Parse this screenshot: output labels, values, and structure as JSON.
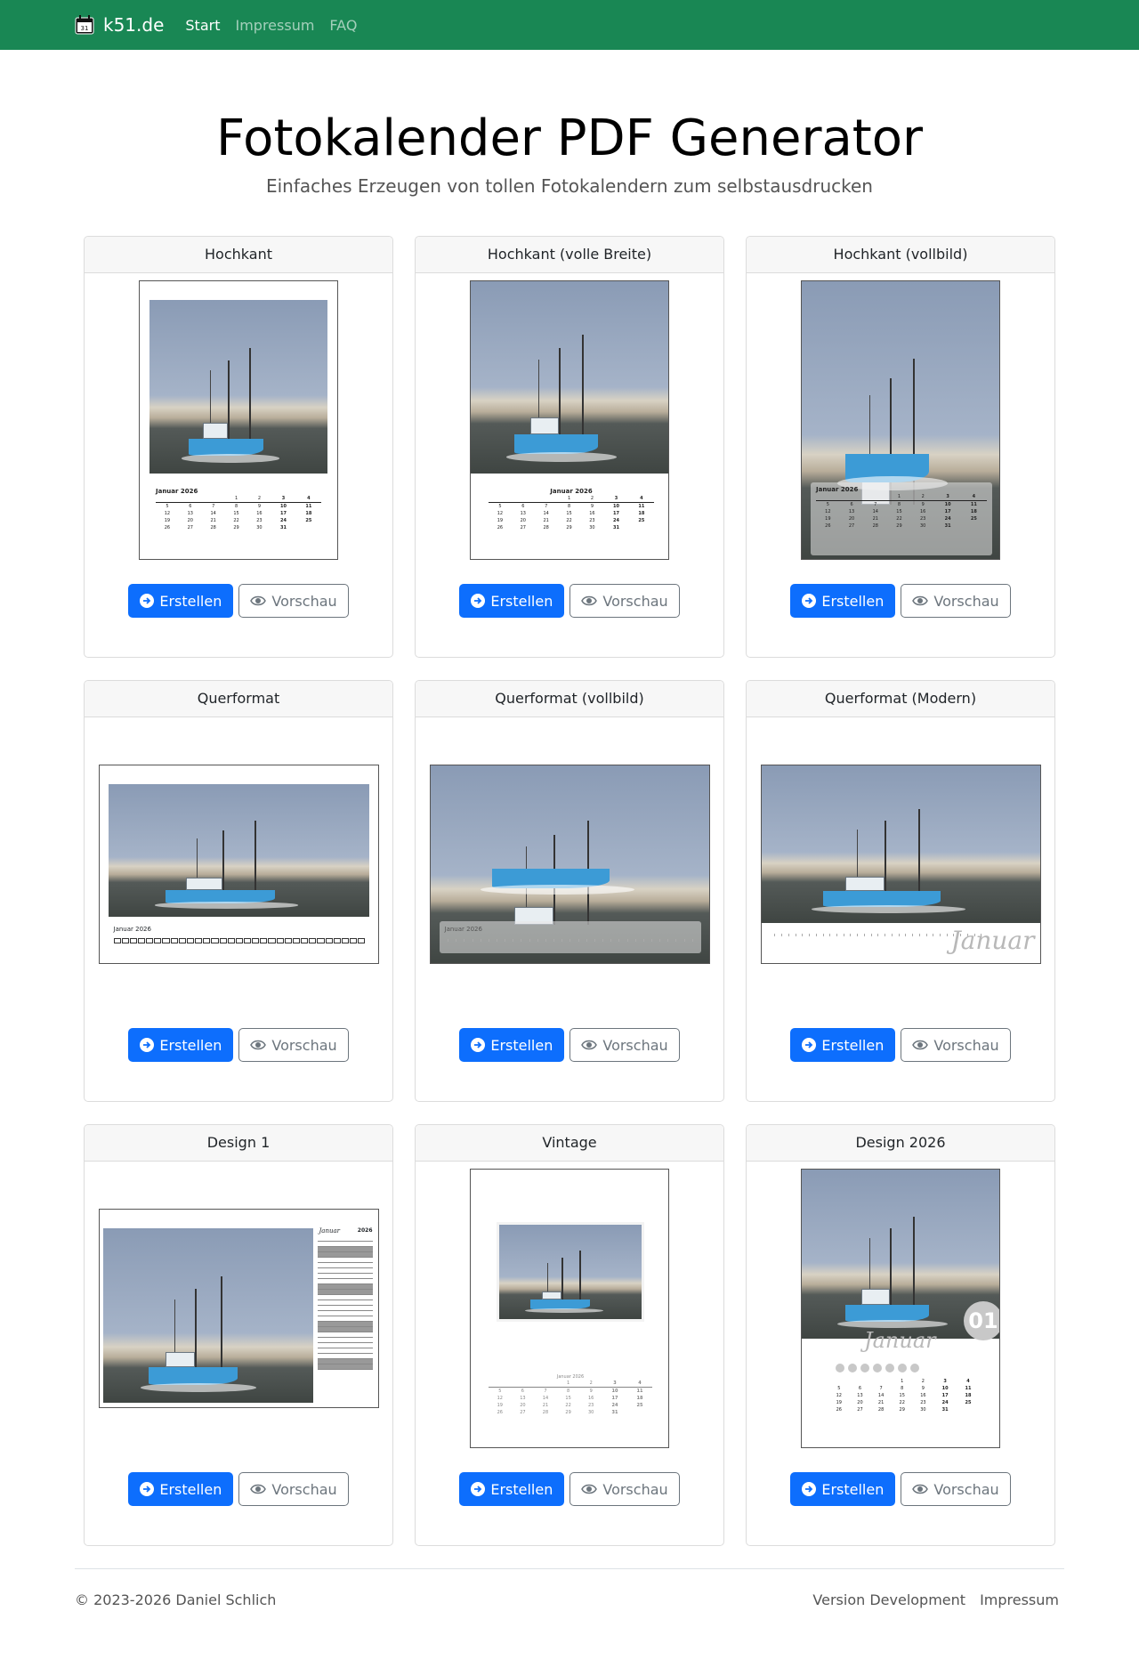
{
  "navbar": {
    "brand": "k51.de",
    "links": [
      "Start",
      "Impressum",
      "FAQ"
    ]
  },
  "hero": {
    "title": "Fotokalender PDF Generator",
    "subtitle": "Einfaches Erzeugen von tollen Fotokalendern zum selbstausdrucken"
  },
  "buttons": {
    "create": "Erstellen",
    "preview": "Vorschau"
  },
  "cards": [
    {
      "title": "Hochkant",
      "month": "Januar 2026"
    },
    {
      "title": "Hochkant (volle Breite)",
      "month": "Januar 2026"
    },
    {
      "title": "Hochkant (vollbild)",
      "month": "Januar 2026"
    },
    {
      "title": "Querformat",
      "month": "Januar 2026"
    },
    {
      "title": "Querformat (vollbild)",
      "month": "Januar 2026"
    },
    {
      "title": "Querformat (Modern)",
      "month": "Januar"
    },
    {
      "title": "Design 1",
      "month": "Januar",
      "year": "2026"
    },
    {
      "title": "Vintage",
      "month": "Januar 2026"
    },
    {
      "title": "Design 2026",
      "month": "Januar",
      "number": "01"
    }
  ],
  "calendar_rows": [
    [
      "",
      "",
      "",
      "1",
      "2",
      "3",
      "4"
    ],
    [
      "5",
      "6",
      "7",
      "8",
      "9",
      "10",
      "11"
    ],
    [
      "12",
      "13",
      "14",
      "15",
      "16",
      "17",
      "18"
    ],
    [
      "19",
      "20",
      "21",
      "22",
      "23",
      "24",
      "25"
    ],
    [
      "26",
      "27",
      "28",
      "29",
      "30",
      "31",
      ""
    ]
  ],
  "footer": {
    "copyright": "© 2023-2026 Daniel Schlich",
    "version": "Version Development",
    "impressum": "Impressum"
  },
  "colors": {
    "navbar": "#198754",
    "primary": "#0d6efd",
    "secondary": "#6c757d"
  }
}
